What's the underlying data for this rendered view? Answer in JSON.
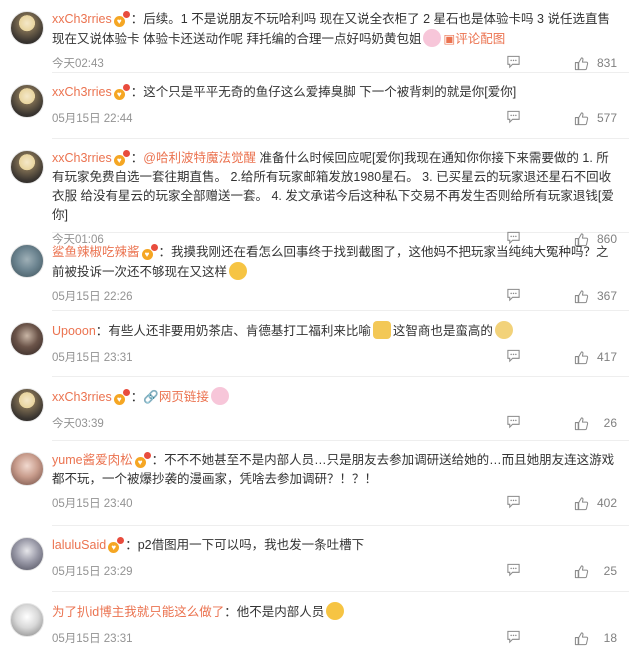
{
  "comments": [
    {
      "user": "xxCh3rries",
      "separator": "：",
      "content": "后续。1 不是说朋友不玩哈利吗 现在又说全衣柜了 2 星石也是体验卡吗 3 说任选直售现在又说体验卡 体验卡还送动作呢 拜托编的合理一点好吗奶黄包姐",
      "link": "评论配图",
      "time": "今天02:43",
      "likes": "831"
    },
    {
      "user": "xxCh3rries",
      "separator": "：",
      "content": "这个只是平平无奇的鱼仔这么爱捧臭脚 下一个被背刺的就是你[爱你]",
      "time": "05月15日 22:44",
      "likes": "577"
    },
    {
      "user": "xxCh3rries",
      "separator": "：",
      "mention": "@哈利波特魔法觉醒",
      "content": " 准备什么时候回应呢[爱你]我现在通知你你接下来需要做的 1. 所有玩家免费自选一套往期直售。 2.给所有玩家邮箱发放1980星石。 3. 已买星云的玩家退还星石不回收衣服 给没有星云的玩家全部赠送一套。 4. 发文承诺今后这种私下交易不再发生否则给所有玩家退钱[爱你]",
      "time": "今天01:06",
      "likes": "860"
    },
    {
      "user": "鲨鱼辣椒吃辣酱",
      "separator": "：",
      "content": "我摸我刚还在看怎么回事终于找到截图了，这他妈不把玩家当纯纯大冤种吗？之前被投诉一次还不够现在又这样",
      "time": "05月15日 22:26",
      "likes": "367"
    },
    {
      "user": "Upooon",
      "separator": "：",
      "content": "有些人还非要用奶茶店、肯德基打工福利来比喻",
      "content2": "这智商也是蛮高的",
      "time": "05月15日 23:31",
      "likes": "417"
    },
    {
      "user": "xxCh3rries",
      "separator": "：",
      "link": "网页链接",
      "time": "今天03:39",
      "likes": "26"
    },
    {
      "user": "yume酱爱肉松",
      "separator": "：",
      "content": "不不不她甚至不是内部人员…只是朋友去参加调研送给她的…而且她朋友连这游戏都不玩，一个被爆抄袭的漫画家，凭啥去参加调研？！？！",
      "time": "05月15日 23:40",
      "likes": "402"
    },
    {
      "user": "laluluSaid",
      "separator": "：",
      "content": "p2借图用一下可以吗，我也发一条吐槽下",
      "time": "05月15日 23:29",
      "likes": "25"
    },
    {
      "user": "为了扒id博主我就只能这么做了",
      "separator": "：",
      "content": "他不是内部人员",
      "time": "05月15日 23:31",
      "likes": "18"
    }
  ],
  "icons": {
    "reply": "comment-icon",
    "like": "thumbs-up-icon",
    "badge": "vip-badge-icon"
  },
  "colors": {
    "username": "#eb7350",
    "text": "#333333",
    "meta": "#939393",
    "divider": "#eeeeee"
  }
}
